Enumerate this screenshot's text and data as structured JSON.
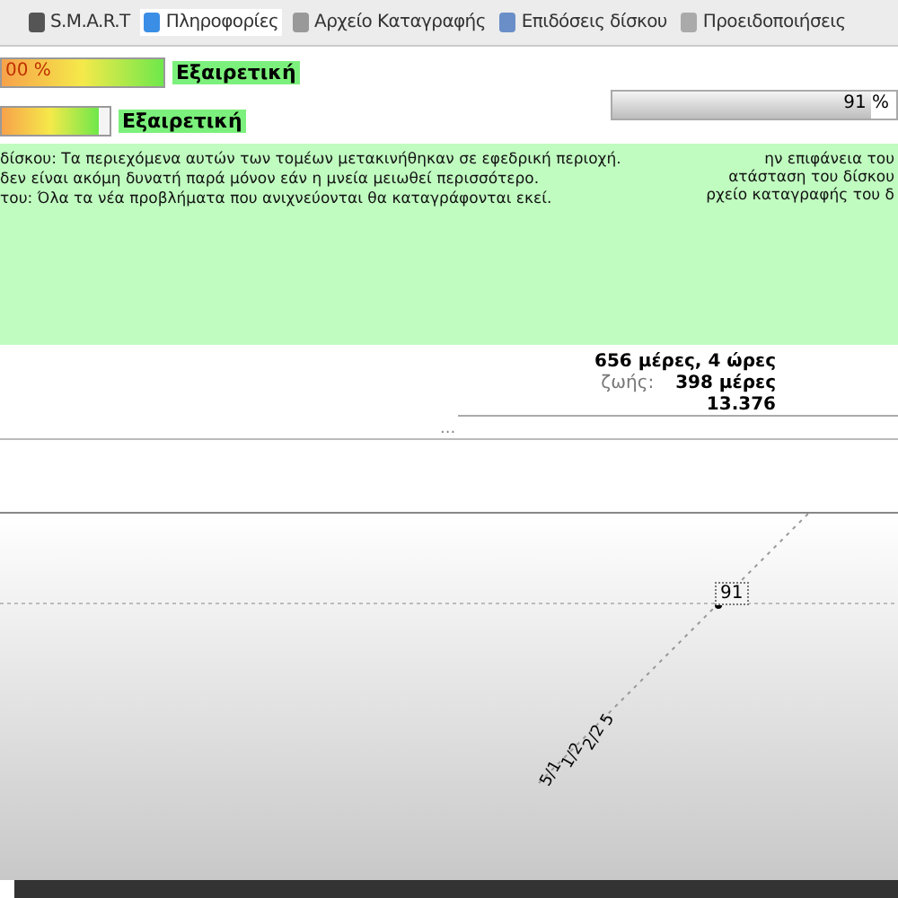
{
  "tabs": [
    {
      "label": "S.M.A.R.T",
      "selected": false
    },
    {
      "label": "Πληροφορίες",
      "selected": true
    },
    {
      "label": "Αρχείο Καταγραφής",
      "selected": false
    },
    {
      "label": "Επιδόσεις δίσκου",
      "selected": false
    },
    {
      "label": "Προειδοποιήσεις",
      "selected": false
    }
  ],
  "health": [
    {
      "reading": "00 %",
      "level": 1,
      "rating": "Εξαιρετική"
    },
    {
      "level": 0.9,
      "rating": "Εξαιρετική"
    }
  ],
  "side_meter": {
    "reading": "91 %",
    "level": 0.91
  },
  "messages": [
    "δίσκου: Τα περιεχόμενα αυτών των τομέων μετακινήθηκαν σε εφεδρική περιοχή.",
    "δεν είναι ακόμη δυνατή παρά μόνον εάν η μνεία μειωθεί περισσότερο.",
    "του: Όλα τα νέα προβλήματα που ανιχνεύονται θα καταγράφονται εκεί."
  ],
  "side_messages": [
    "ην επιφάνεια του",
    "ατάσταση του δίσκου",
    "ρχείο καταγραφής του δ"
  ],
  "stats": [
    {
      "value": "656 μέρες, 4 ώρες"
    },
    {
      "label": "ζωής:",
      "value": "398 μέρες"
    },
    {
      "value": "13.376"
    }
  ],
  "ellipsis": "...",
  "chart": {
    "point_label": "91",
    "x_labels": [
      "5/1",
      "1/2",
      "2/2",
      "5"
    ]
  }
}
